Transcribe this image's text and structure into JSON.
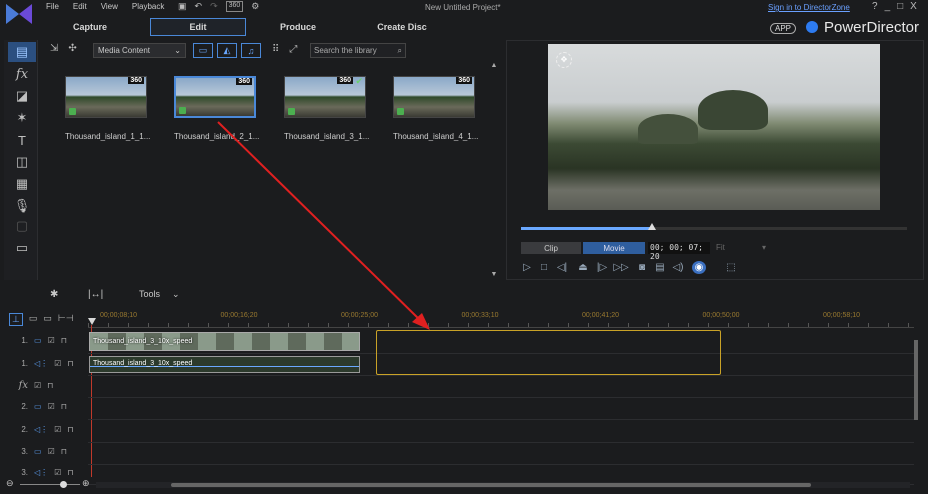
{
  "app": {
    "project_title": "New Untitled Project*",
    "sign_in": "Sign in to DirectorZone",
    "app_badge": "APP",
    "brand": "PowerDirector",
    "window_controls": [
      "?",
      "_",
      "□",
      "X"
    ]
  },
  "menu": [
    "File",
    "Edit",
    "View",
    "Playback"
  ],
  "toolbar_icons": [
    "save-icon",
    "undo-icon",
    "redo-icon",
    "360-icon",
    "settings-icon"
  ],
  "toolbar_360": "360",
  "tabs": [
    {
      "label": "Capture",
      "active": false
    },
    {
      "label": "Edit",
      "active": true
    },
    {
      "label": "Produce",
      "active": false
    },
    {
      "label": "Create Disc",
      "active": false
    }
  ],
  "library": {
    "dropdown": "Media Content",
    "search_placeholder": "Search the library",
    "items": [
      {
        "name": "Thousand_island_1_1...",
        "badge": "360",
        "selected": false,
        "checked": false
      },
      {
        "name": "Thousand_island_2_1...",
        "badge": "360",
        "selected": true,
        "checked": false
      },
      {
        "name": "Thousand_island_3_1...",
        "badge": "360",
        "selected": false,
        "checked": true
      },
      {
        "name": "Thousand_island_4_1...",
        "badge": "360",
        "selected": false,
        "checked": false
      }
    ]
  },
  "sidebar_icons": [
    "media-room-icon",
    "fx-icon",
    "pip-icon",
    "particle-icon",
    "title-icon",
    "transition-icon",
    "audio-mix-icon",
    "voiceover-icon",
    "chapter-icon",
    "subtitle-icon"
  ],
  "sidebar_fx": "fx",
  "sidebar_title": "T",
  "preview": {
    "clip_label": "Clip",
    "movie_label": "Movie",
    "timecode": "00; 00; 07; 20",
    "quality": "Fit",
    "progress": 0.34
  },
  "timeline_tools": {
    "tools_label": "Tools"
  },
  "ruler": [
    "00;00;08;10",
    "00;00;16;20",
    "00;00;25;00",
    "00;00;33;10",
    "00;00;41;20",
    "00;00;50;00",
    "00;00;58;10"
  ],
  "tracks": [
    {
      "label": "1.",
      "type": "video"
    },
    {
      "label": "1.",
      "type": "audio"
    },
    {
      "label": "fx",
      "type": "fx"
    },
    {
      "label": "2.",
      "type": "video"
    },
    {
      "label": "2.",
      "type": "audio"
    },
    {
      "label": "3.",
      "type": "video"
    },
    {
      "label": "3.",
      "type": "audio"
    }
  ],
  "clips": {
    "video": "Thousand_island_3_10x_speed",
    "audio": "Thousand_island_3_10x_speed"
  }
}
